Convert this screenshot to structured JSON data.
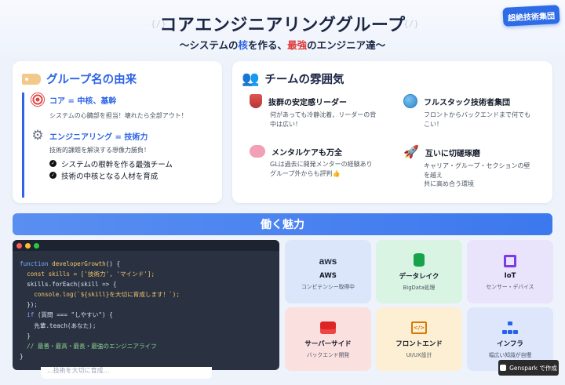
{
  "header": {
    "title": "コアエンジニアリンググループ",
    "subtitle_parts": [
      "〜システムの",
      "核",
      "を作る、",
      "最強",
      "のエンジニア達〜"
    ],
    "badge": "超絶技術集団",
    "deco_left": "{/}",
    "deco_right": "{/}"
  },
  "origin_card": {
    "heading": "グループ名の由来",
    "items": [
      {
        "title": "コア = 中核、基幹",
        "desc": "システムの心臓部を担当！壊れたら全部アウト！",
        "icon": "target-icon"
      },
      {
        "title": "エンジニアリング = 技術力",
        "desc": "技術的課題を解決する想像力勝負！",
        "icon": "gear-icon"
      }
    ],
    "bullets": [
      "システムの根幹を作る最強チーム",
      "技術の中核となる人材を育成"
    ]
  },
  "team_card": {
    "heading": "チームの雰囲気",
    "traits": [
      {
        "title": "抜群の安定感リーダー",
        "desc": [
          "何があっても冷静沈着、リーダーの背",
          "中は広い！"
        ],
        "icon": "shield-icon"
      },
      {
        "title": "フルスタック技術者集団",
        "desc": [
          "フロントからバックエンドまで何でも",
          "こい！"
        ],
        "icon": "globe-icon"
      },
      {
        "title": "メンタルケアも万全",
        "desc": [
          "GLは過去に開発メンターの経験あり",
          "グループ外からも評判👍"
        ],
        "icon": "brain-icon"
      },
      {
        "title": "互いに切磋琢磨",
        "desc": [
          "キャリア・グループ・セクションの壁",
          "を越え",
          "共に高め合う環境"
        ],
        "icon": "rocket-icon"
      }
    ]
  },
  "banner": {
    "label": "働く魅力"
  },
  "code": {
    "lines": [
      "function developerGrowth() {",
      "  const skills = ['技術力', 'マインド'];",
      "  skills.forEach(skill => {",
      "    console.log(`${skill}を大切に育成します！`);",
      "  });",
      "  if (質問 === \"しやすい\") {",
      "    先輩.teach(あなた);",
      "  }",
      "  // 最善・最高・最長・最強のエンジニアライフ",
      "}"
    ]
  },
  "tiles": [
    {
      "name": "AWS",
      "sub": "コンピテンシー取得中",
      "icon": "aws-icon",
      "bg": "#dbe6fb"
    },
    {
      "name": "データレイク",
      "sub": "BigData処理",
      "icon": "database-icon",
      "bg": "#d9f4e3"
    },
    {
      "name": "IoT",
      "sub": "センサー・デバイス",
      "icon": "chip-icon",
      "bg": "#e9e3fb"
    },
    {
      "name": "サーバーサイド",
      "sub": "バックエンド開発",
      "icon": "server-icon",
      "bg": "#fbe0e0"
    },
    {
      "name": "フロントエンド",
      "sub": "UI/UX設計",
      "icon": "code-icon",
      "bg": "#fcefd3"
    },
    {
      "name": "インフラ",
      "sub": "幅広い知識が自慢",
      "icon": "network-icon",
      "bg": "#dde6fb"
    }
  ],
  "tile_icon_text": {
    "aws": "aws",
    "code": "</>"
  },
  "partial_text": "...技術を大切に育成...",
  "genspark": {
    "label": "Genspark で作成"
  }
}
